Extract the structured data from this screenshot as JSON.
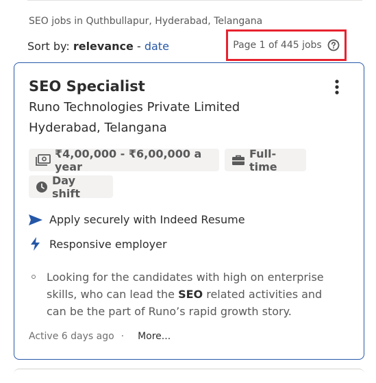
{
  "location_line": "SEO jobs in Quthbullapur, Hyderabad, Telangana",
  "sort": {
    "label": "Sort by:",
    "active": "relevance",
    "separator": "-",
    "alt": "date"
  },
  "page_count": "Page 1 of 445 jobs",
  "job": {
    "title": "SEO Specialist",
    "company": "Runo Technologies Private Limited",
    "location": "Hyderabad, Telangana",
    "salary": "₹4,00,000 - ₹6,00,000 a year",
    "job_type": "Full-time",
    "shift": "Day shift",
    "feature_apply": "Apply securely with Indeed Resume",
    "feature_responsive": "Responsive employer",
    "snippet_pre": "Looking for the candidates with high on enterprise skills, who can lead the ",
    "snippet_highlight": "SEO",
    "snippet_post": " related activities and can be the part of Runo’s rapid growth story.",
    "posted": "Active 6 days ago",
    "dot": "·",
    "more": "More..."
  },
  "colors": {
    "accent": "#2557a7",
    "highlight_box": "#e8212e",
    "chip_bg": "#f3f2f1"
  }
}
